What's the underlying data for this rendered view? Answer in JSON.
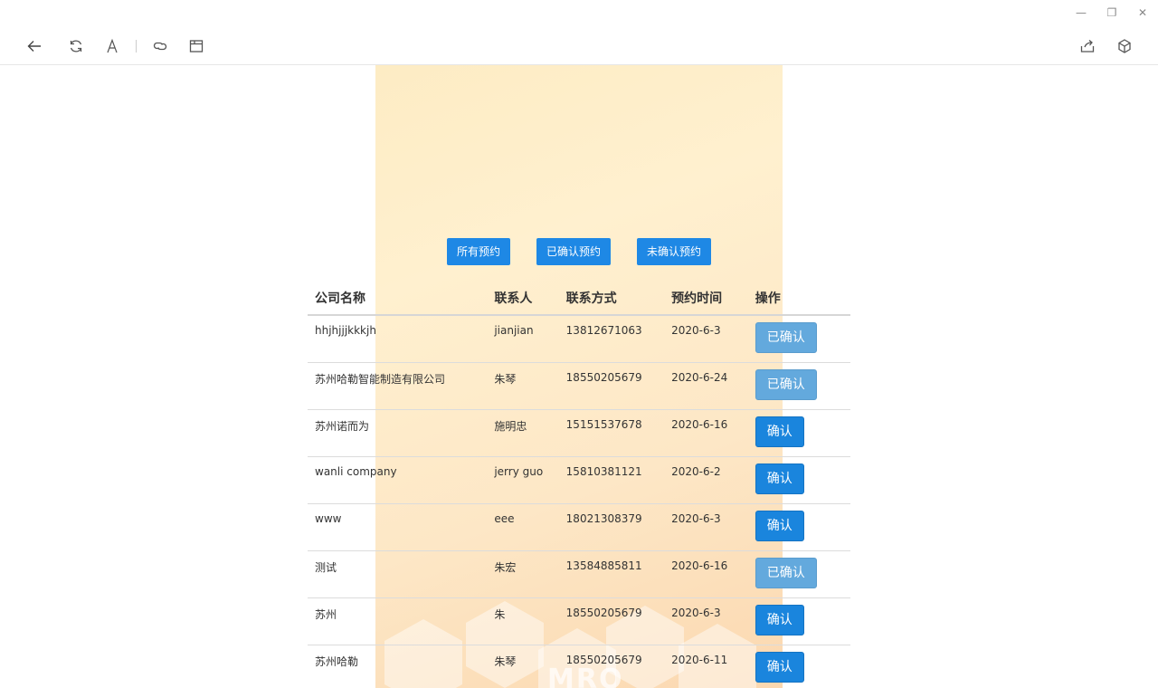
{
  "window": {
    "minimize_icon": "—",
    "restore_icon": "❐",
    "close_icon": "✕"
  },
  "toolbar": {
    "icons": [
      "back-arrow-icon",
      "refresh-icon",
      "text-size-icon",
      "link-icon",
      "window-icon",
      "share-icon",
      "cube-icon"
    ]
  },
  "filters": {
    "all": "所有预约",
    "confirmed": "已确认预约",
    "unconfirmed": "未确认预约"
  },
  "table": {
    "headers": {
      "company": "公司名称",
      "contact": "联系人",
      "phone": "联系方式",
      "date": "预约时间",
      "action": "操作"
    },
    "rows": [
      {
        "company": "hhjhjjjkkkjh",
        "contact": "jianjian",
        "phone": "13812671063",
        "date": "2020-6-3",
        "action": "已确认",
        "status": "confirmed"
      },
      {
        "company": "苏州哈勒智能制造有限公司",
        "contact": "朱琴",
        "phone": "18550205679",
        "date": "2020-6-24",
        "action": "已确认",
        "status": "confirmed"
      },
      {
        "company": "苏州诺而为",
        "contact": "施明忠",
        "phone": "15151537678",
        "date": "2020-6-16",
        "action": "确认",
        "status": "pending"
      },
      {
        "company": "wanli company",
        "contact": "jerry guo",
        "phone": "15810381121",
        "date": "2020-6-2",
        "action": "确认",
        "status": "pending"
      },
      {
        "company": "www",
        "contact": "eee",
        "phone": "18021308379",
        "date": "2020-6-3",
        "action": "确认",
        "status": "pending"
      },
      {
        "company": "测试",
        "contact": "朱宏",
        "phone": "13584885811",
        "date": "2020-6-16",
        "action": "已确认",
        "status": "confirmed"
      },
      {
        "company": "苏州",
        "contact": "朱",
        "phone": "18550205679",
        "date": "2020-6-3",
        "action": "确认",
        "status": "pending"
      },
      {
        "company": "苏州哈勒",
        "contact": "朱琴",
        "phone": "18550205679",
        "date": "2020-6-11",
        "action": "确认",
        "status": "pending"
      }
    ]
  },
  "background": {
    "watermark": "MRO"
  },
  "colors": {
    "primary": "#1a85dd",
    "confirmed": "#63a9dd",
    "panel": "#fdecc4"
  }
}
